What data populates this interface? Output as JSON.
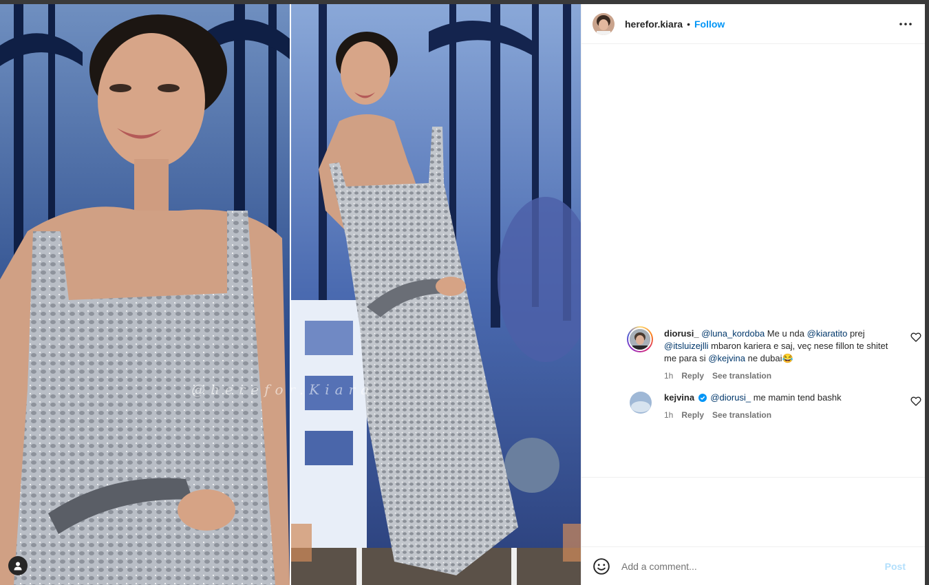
{
  "post": {
    "username": "herefor.kiara",
    "separator": "•",
    "follow_label": "Follow",
    "watermark": "@herefor.Kiara"
  },
  "comments": [
    {
      "username": "diorusi_",
      "mention1": "@luna_kordoba",
      "text1": " Me u nda ",
      "mention2": "@kiaratito",
      "text2": " prej ",
      "mention3": "@itsluizejlli",
      "text3": " mbaron kariera e saj, veç nese fillon te shitet me para si ",
      "mention4": "@kejvina",
      "text4": " ne dubai😂",
      "time": "1h",
      "reply_label": "Reply",
      "translation_label": "See translation"
    },
    {
      "username": "kejvina",
      "mention1": "@diorusi_",
      "text1": " me mamin tend bashk",
      "time": "1h",
      "reply_label": "Reply",
      "translation_label": "See translation"
    }
  ],
  "composer": {
    "placeholder": "Add a comment...",
    "post_label": "Post"
  },
  "colors": {
    "accent": "#0095f6",
    "mention": "#00376b",
    "post_disabled": "#b2dffc"
  },
  "icons": [
    "user-tag-icon",
    "more-options-icon",
    "heart-icon",
    "verified-badge-icon",
    "emoji-icon"
  ]
}
